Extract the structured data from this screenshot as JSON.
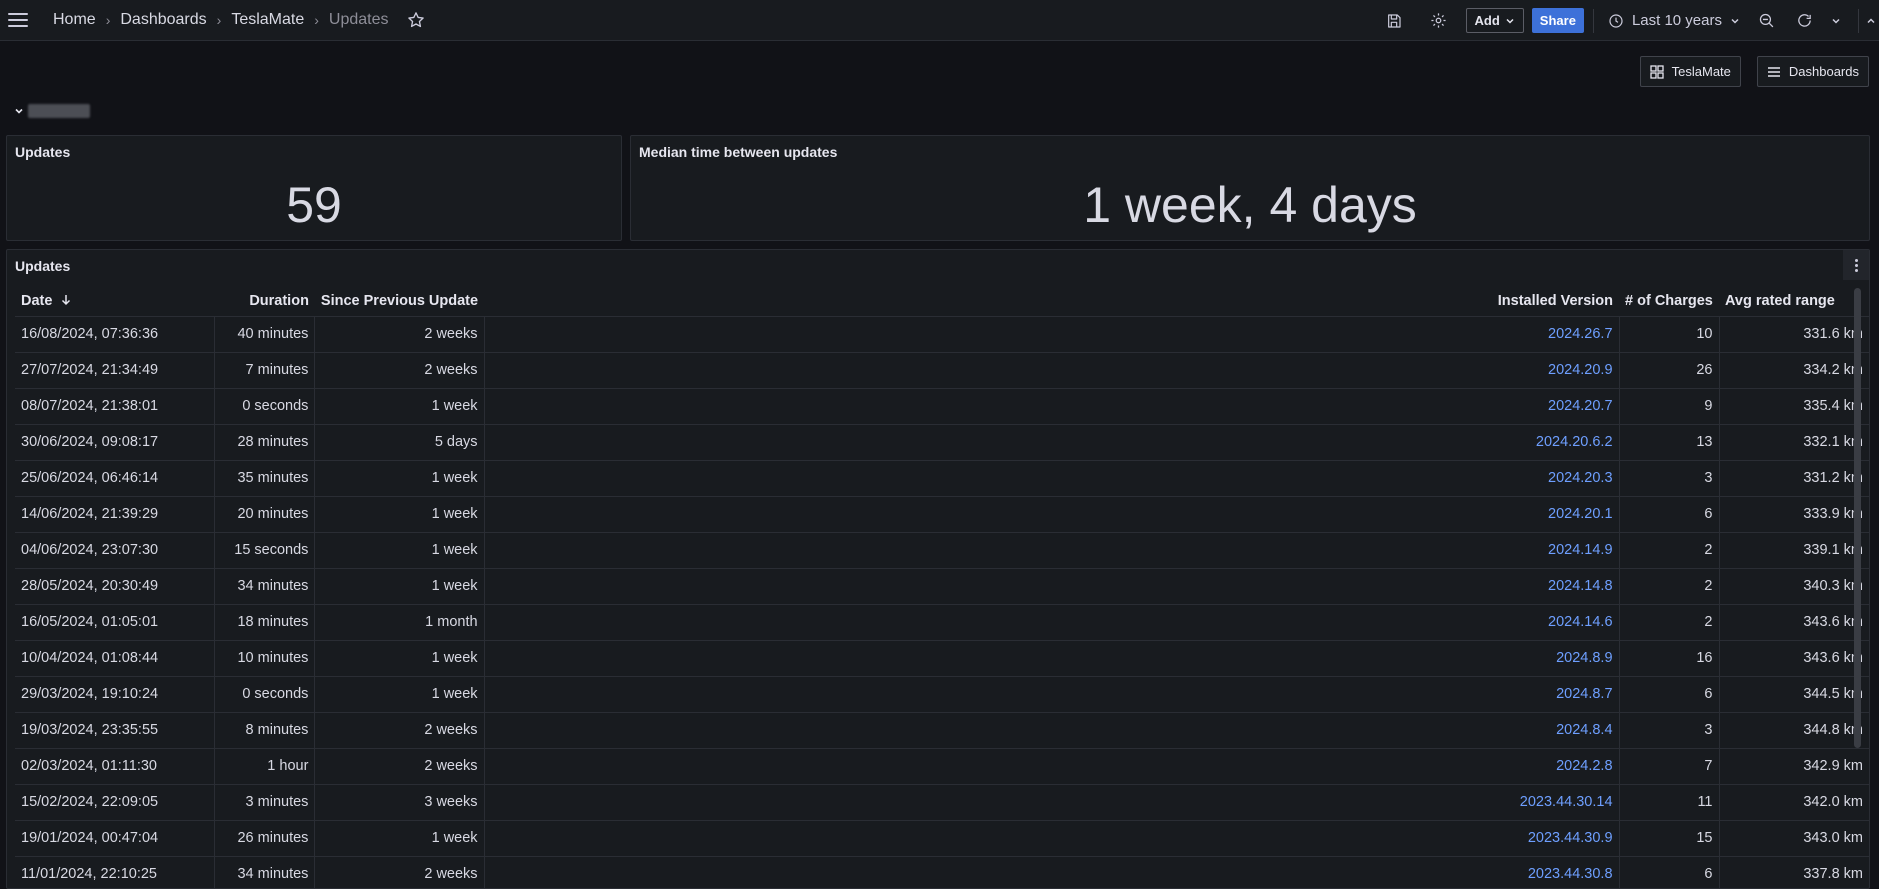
{
  "breadcrumb": {
    "home": "Home",
    "dashboards": "Dashboards",
    "folder": "TeslaMate",
    "current": "Updates"
  },
  "toolbar": {
    "add_label": "Add",
    "share_label": "Share",
    "time_range": "Last 10 years"
  },
  "nav_buttons": {
    "teslamate": "TeslaMate",
    "dashboards": "Dashboards"
  },
  "stats": {
    "updates": {
      "title": "Updates",
      "value": "59"
    },
    "median": {
      "title": "Median time between updates",
      "value": "1 week, 4 days"
    }
  },
  "table": {
    "title": "Updates",
    "headers": {
      "date": "Date",
      "duration": "Duration",
      "since": "Since Previous Update",
      "version": "Installed Version",
      "charges": "# of Charges",
      "range": "Avg rated range"
    },
    "rows": [
      {
        "date": "16/08/2024, 07:36:36",
        "duration": "40 minutes",
        "since": "2 weeks",
        "version": "2024.26.7",
        "charges": "10",
        "range": "331.6 km"
      },
      {
        "date": "27/07/2024, 21:34:49",
        "duration": "7 minutes",
        "since": "2 weeks",
        "version": "2024.20.9",
        "charges": "26",
        "range": "334.2 km"
      },
      {
        "date": "08/07/2024, 21:38:01",
        "duration": "0 seconds",
        "since": "1 week",
        "version": "2024.20.7",
        "charges": "9",
        "range": "335.4 km"
      },
      {
        "date": "30/06/2024, 09:08:17",
        "duration": "28 minutes",
        "since": "5 days",
        "version": "2024.20.6.2",
        "charges": "13",
        "range": "332.1 km"
      },
      {
        "date": "25/06/2024, 06:46:14",
        "duration": "35 minutes",
        "since": "1 week",
        "version": "2024.20.3",
        "charges": "3",
        "range": "331.2 km"
      },
      {
        "date": "14/06/2024, 21:39:29",
        "duration": "20 minutes",
        "since": "1 week",
        "version": "2024.20.1",
        "charges": "6",
        "range": "333.9 km"
      },
      {
        "date": "04/06/2024, 23:07:30",
        "duration": "15 seconds",
        "since": "1 week",
        "version": "2024.14.9",
        "charges": "2",
        "range": "339.1 km"
      },
      {
        "date": "28/05/2024, 20:30:49",
        "duration": "34 minutes",
        "since": "1 week",
        "version": "2024.14.8",
        "charges": "2",
        "range": "340.3 km"
      },
      {
        "date": "16/05/2024, 01:05:01",
        "duration": "18 minutes",
        "since": "1 month",
        "version": "2024.14.6",
        "charges": "2",
        "range": "343.6 km"
      },
      {
        "date": "10/04/2024, 01:08:44",
        "duration": "10 minutes",
        "since": "1 week",
        "version": "2024.8.9",
        "charges": "16",
        "range": "343.6 km"
      },
      {
        "date": "29/03/2024, 19:10:24",
        "duration": "0 seconds",
        "since": "1 week",
        "version": "2024.8.7",
        "charges": "6",
        "range": "344.5 km"
      },
      {
        "date": "19/03/2024, 23:35:55",
        "duration": "8 minutes",
        "since": "2 weeks",
        "version": "2024.8.4",
        "charges": "3",
        "range": "344.8 km"
      },
      {
        "date": "02/03/2024, 01:11:30",
        "duration": "1 hour",
        "since": "2 weeks",
        "version": "2024.2.8",
        "charges": "7",
        "range": "342.9 km"
      },
      {
        "date": "15/02/2024, 22:09:05",
        "duration": "3 minutes",
        "since": "3 weeks",
        "version": "2023.44.30.14",
        "charges": "11",
        "range": "342.0 km"
      },
      {
        "date": "19/01/2024, 00:47:04",
        "duration": "26 minutes",
        "since": "1 week",
        "version": "2023.44.30.9",
        "charges": "15",
        "range": "343.0 km"
      },
      {
        "date": "11/01/2024, 22:10:25",
        "duration": "34 minutes",
        "since": "2 weeks",
        "version": "2023.44.30.8",
        "charges": "6",
        "range": "337.8 km"
      }
    ]
  },
  "colors": {
    "link": "#6e9fff",
    "share": "#3d71d9",
    "panel": "#181b1f",
    "background": "#111217"
  }
}
